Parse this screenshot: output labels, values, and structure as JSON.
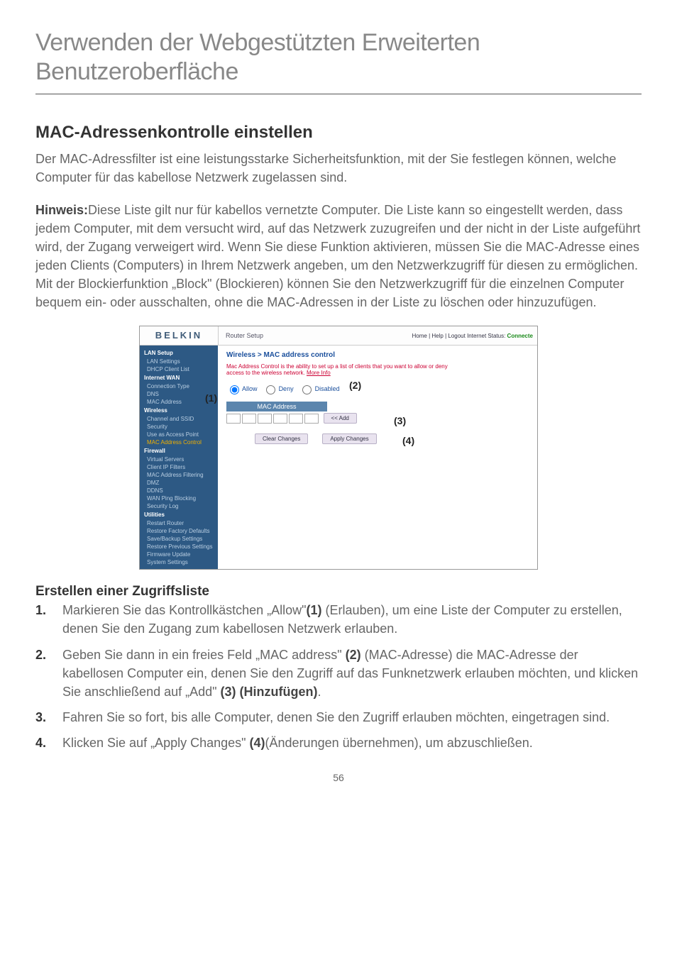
{
  "page_title": "Verwenden der Webgestützten Erweiterten Benutzeroberfläche",
  "section_heading": "MAC-Adressenkontrolle einstellen",
  "intro_para": "Der MAC-Adressfilter ist eine leistungsstarke Sicherheitsfunktion, mit der Sie festlegen können, welche Computer für das kabellose Netzwerk zugelassen sind.",
  "hinweis_label": "Hinweis:",
  "hinweis_body": "Diese Liste gilt nur für kabellos vernetzte Computer. Die Liste kann so eingestellt werden, dass jedem Computer, mit dem versucht wird, auf das Netzwerk zuzugreifen und der nicht in der Liste aufgeführt wird, der Zugang verweigert wird. Wenn Sie diese Funktion aktivieren, müssen Sie die MAC-Adresse eines jeden Clients (Computers) in Ihrem Netzwerk angeben, um den Netzwerkzugriff für diesen zu ermöglichen. Mit der Blockierfunktion „Block\" (Blockieren) können Sie den Netzwerkzugriff für die einzelnen Computer bequem ein- oder ausschalten, ohne die MAC-Adressen in der Liste zu löschen oder hinzuzufügen.",
  "subheading": "Erstellen einer Zugriffsliste",
  "steps": {
    "s1a": "Markieren Sie das Kontrollkästchen „Allow\"",
    "s1b": "(1)",
    "s1c": " (Erlauben), um eine Liste der Computer zu erstellen, denen Sie den Zugang zum kabellosen Netzwerk erlauben.",
    "s2a": "Geben Sie dann in ein freies Feld „MAC address\" ",
    "s2b": "(2)",
    "s2c": " (MAC-Adresse) die MAC-Adresse der kabellosen Computer ein, denen Sie den Zugriff auf das Funknetzwerk erlauben möchten, und klicken Sie anschließend auf „Add\" ",
    "s2d": "(3) (Hinzufügen)",
    "s2e": ".",
    "s3": "Fahren Sie so fort, bis alle Computer, denen Sie den Zugriff erlauben möchten, eingetragen sind.",
    "s4a": "Klicken Sie auf „Apply Changes\" ",
    "s4b": "(4)",
    "s4c": "(Änderungen übernehmen), um abzuschließen."
  },
  "page_number": "56",
  "screenshot": {
    "logo": "BELKIN",
    "router_setup": "Router Setup",
    "status_links": "Home | Help | Logout   Internet Status: ",
    "status_conn": "Connecte",
    "nav": {
      "lan_setup": "LAN Setup",
      "lan_settings": "LAN Settings",
      "dhcp": "DHCP Client List",
      "internet_wan": "Internet WAN",
      "conn_type": "Connection Type",
      "dns": "DNS",
      "mac_address": "MAC Address",
      "wireless": "Wireless",
      "channel_ssid": "Channel and SSID",
      "security": "Security",
      "use_ap": "Use as Access Point",
      "mac_ctrl": "MAC Address Control",
      "firewall": "Firewall",
      "virtual_servers": "Virtual Servers",
      "client_ip": "Client IP Filters",
      "mac_filter": "MAC Address Filtering",
      "dmz": "DMZ",
      "ddns": "DDNS",
      "wan_ping": "WAN Ping Blocking",
      "sec_log": "Security Log",
      "utilities": "Utilities",
      "restart": "Restart Router",
      "restore_def": "Restore Factory Defaults",
      "save_backup": "Save/Backup Settings",
      "restore_prev": "Restore Previous Settings",
      "firmware": "Firmware Update",
      "system": "System Settings"
    },
    "main": {
      "crumb": "Wireless > MAC address control",
      "help": "Mac Address Control is the ability to set up a list of clients that you want to allow or deny access to the wireless network. ",
      "more_info": "More Info",
      "radio_allow": "Allow",
      "radio_deny": "Deny",
      "radio_disabled": "Disabled",
      "mac_header": "MAC Address",
      "add_btn": "<< Add",
      "clear_btn": "Clear Changes",
      "apply_btn": "Apply Changes"
    },
    "callouts": {
      "c1": "(1)",
      "c2": "(2)",
      "c3": "(3)",
      "c4": "(4)"
    }
  }
}
